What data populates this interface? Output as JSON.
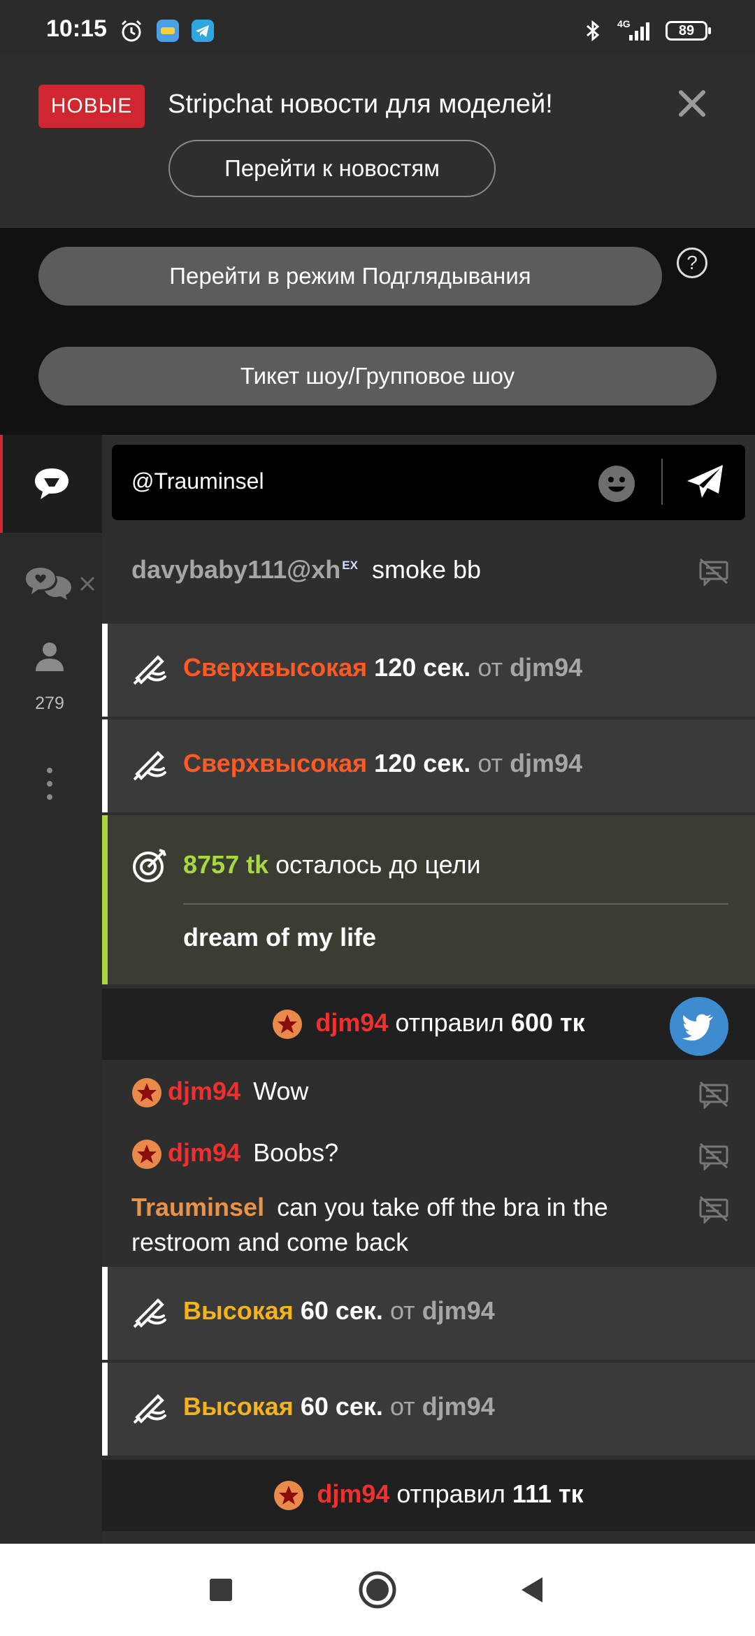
{
  "status_bar": {
    "time": "10:15",
    "icons": [
      "alarm-icon",
      "app-notification-icon",
      "telegram-icon",
      "bluetooth-icon",
      "signal-4g-icon"
    ],
    "network": "4G",
    "battery": "89"
  },
  "news": {
    "badge": "НОВЫЕ",
    "title": "Stripchat новости для моделей!",
    "link_label": "Перейти к новостям",
    "close_icon": "close-icon",
    "badge_color": "#d0262f"
  },
  "actions": {
    "peek_label": "Перейти в режим Подглядывания",
    "help_label": "?",
    "ticket_label": "Тикет шоу/Групповое шоу"
  },
  "sidebar": {
    "items": [
      {
        "icon": "chat-bubble-icon",
        "active": true
      },
      {
        "icon": "private-chats-icon"
      },
      {
        "icon": "users-icon",
        "count": "279"
      },
      {
        "icon": "more-vertical-icon"
      }
    ]
  },
  "chat": {
    "input_value": "@Trauminsel",
    "messages": [
      {
        "type": "message",
        "user": "davybaby111@xh",
        "badge": "EX",
        "text": "smoke bb"
      },
      {
        "type": "boost",
        "level": "Сверхвысокая",
        "duration": "120 сек.",
        "from_label": "от",
        "user": "djm94"
      },
      {
        "type": "boost",
        "level": "Сверхвысокая",
        "duration": "120 сек.",
        "from_label": "от",
        "user": "djm94"
      },
      {
        "type": "goal",
        "amount": "8757 tk",
        "text": "осталось до цели",
        "description": "dream of my life"
      },
      {
        "type": "tip",
        "user": "djm94",
        "verb": "отправил",
        "amount": "600 тк"
      },
      {
        "type": "message",
        "user": "djm94",
        "text": "Wow"
      },
      {
        "type": "message",
        "user": "djm94",
        "text": "Boobs?"
      },
      {
        "type": "message",
        "user": "Trauminsel",
        "text_line1": "can you take off the bra in the",
        "text_line2": "restroom and come back"
      },
      {
        "type": "boost",
        "level": "Высокая",
        "duration": "60 сек.",
        "from_label": "от",
        "user": "djm94"
      },
      {
        "type": "boost",
        "level": "Высокая",
        "duration": "60 сек.",
        "from_label": "от",
        "user": "djm94"
      },
      {
        "type": "tip",
        "user": "djm94",
        "verb": "отправил",
        "amount": "111 тк"
      }
    ]
  },
  "colors": {
    "accent_red": "#d0262f",
    "goal_green": "#a8d83f",
    "boost_super": "#ff5a24",
    "boost_high": "#f5b31b",
    "user_red": "#f0302e",
    "user_orange": "#e8934a",
    "twitter_blue": "#3e8bd0"
  }
}
